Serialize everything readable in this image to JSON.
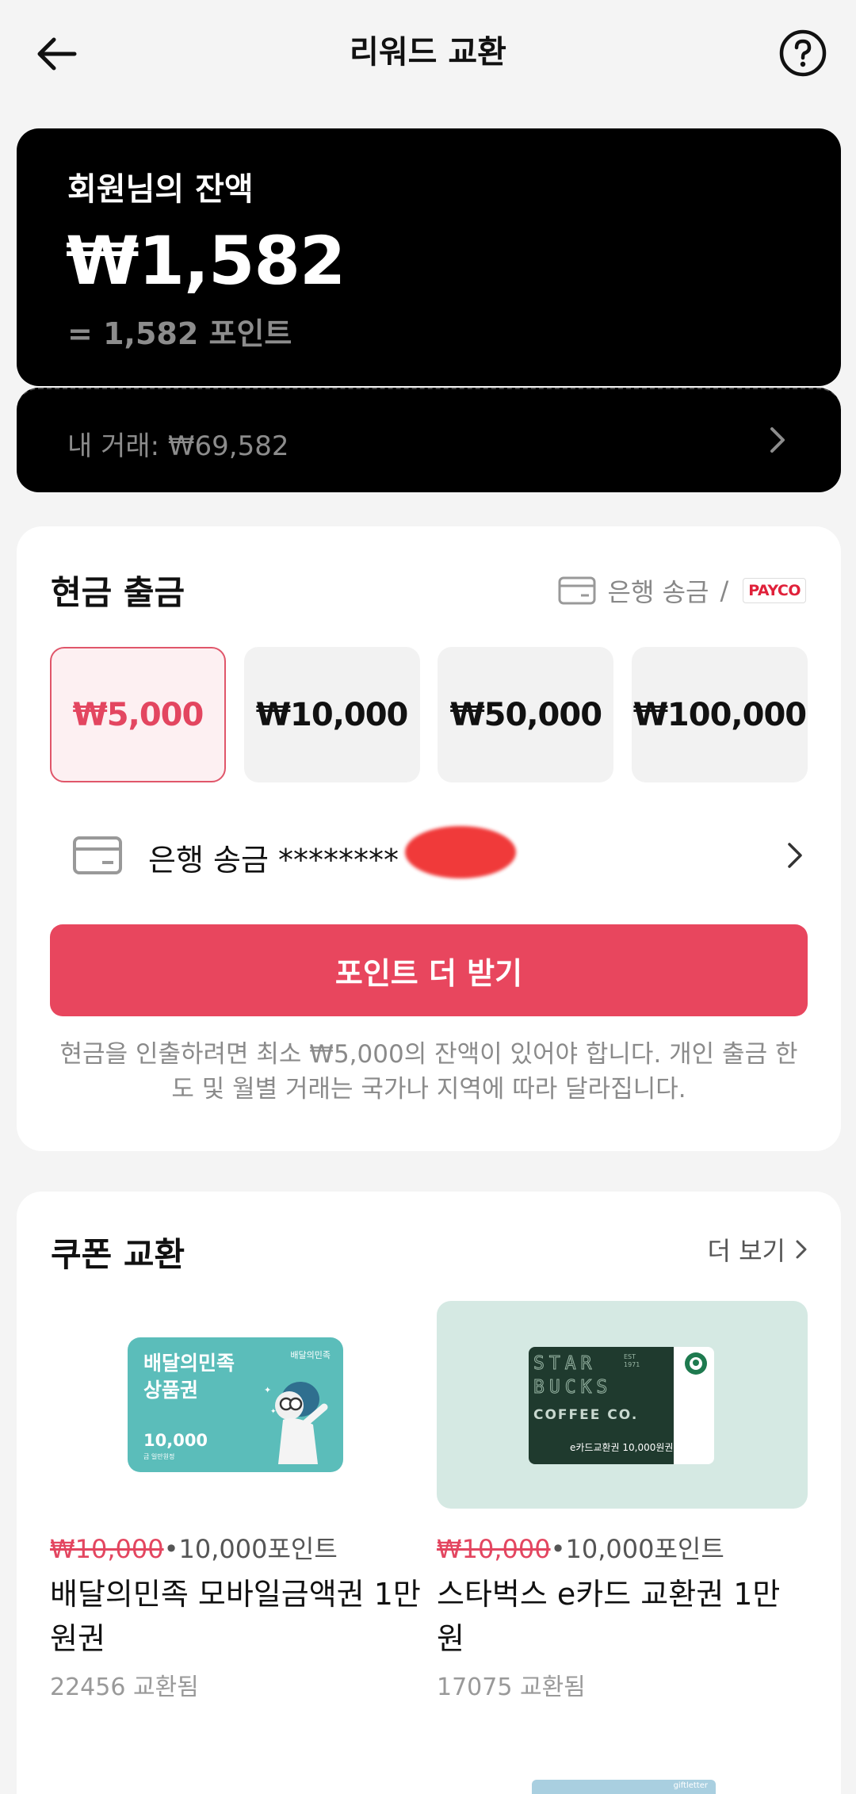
{
  "header": {
    "title": "리워드 교환"
  },
  "balance": {
    "label": "회원님의 잔액",
    "amount": "₩1,582",
    "points": "= 1,582 포인트",
    "transactions": "내 거래: ₩69,582"
  },
  "cash": {
    "title": "현금 출금",
    "method_bank": "은행 송금",
    "method_sep": "/",
    "method_payco": "PAYCO",
    "amounts": [
      "₩5,000",
      "₩10,000",
      "₩50,000",
      "₩100,000"
    ],
    "selected_amount": "₩5,000",
    "bank_account": "은행 송금 ********",
    "button": "포인트 더 받기",
    "notice": "현금을 인출하려면 최소 ₩5,000의 잔액이 있어야 합니다. 개인 출금 한도 및 월별 거래는 국가나 지역에 따라 달라집니다."
  },
  "coupons": {
    "title": "쿠폰 교환",
    "see_more": "더 보기",
    "items": [
      {
        "original_price": "₩10,000",
        "points": "•10,000포인트",
        "name": "배달의민족 모바일금액권 1만원권",
        "exchanged": "22456 교환됨",
        "card_brand": "배달의민족",
        "card_title_1": "배달의민족",
        "card_title_2": "상품권",
        "card_value": "10,000",
        "card_sub": "금 일만원정"
      },
      {
        "original_price": "₩10,000",
        "points": "•10,000포인트",
        "name": "스타벅스 e카드 교환권 1만원",
        "exchanged": "17075 교환됨",
        "card_line1": "STAR",
        "card_line2": "BUCKS",
        "card_line3": "COFFEE CO.",
        "card_year1": "EST",
        "card_year2": "1971",
        "card_value": "e카드교환권 10,000원권"
      }
    ]
  },
  "peek": {
    "label": "giftletter"
  },
  "colors": {
    "accent": "#e8465e",
    "selected_text": "#e34660",
    "card_bg": "#000000"
  }
}
